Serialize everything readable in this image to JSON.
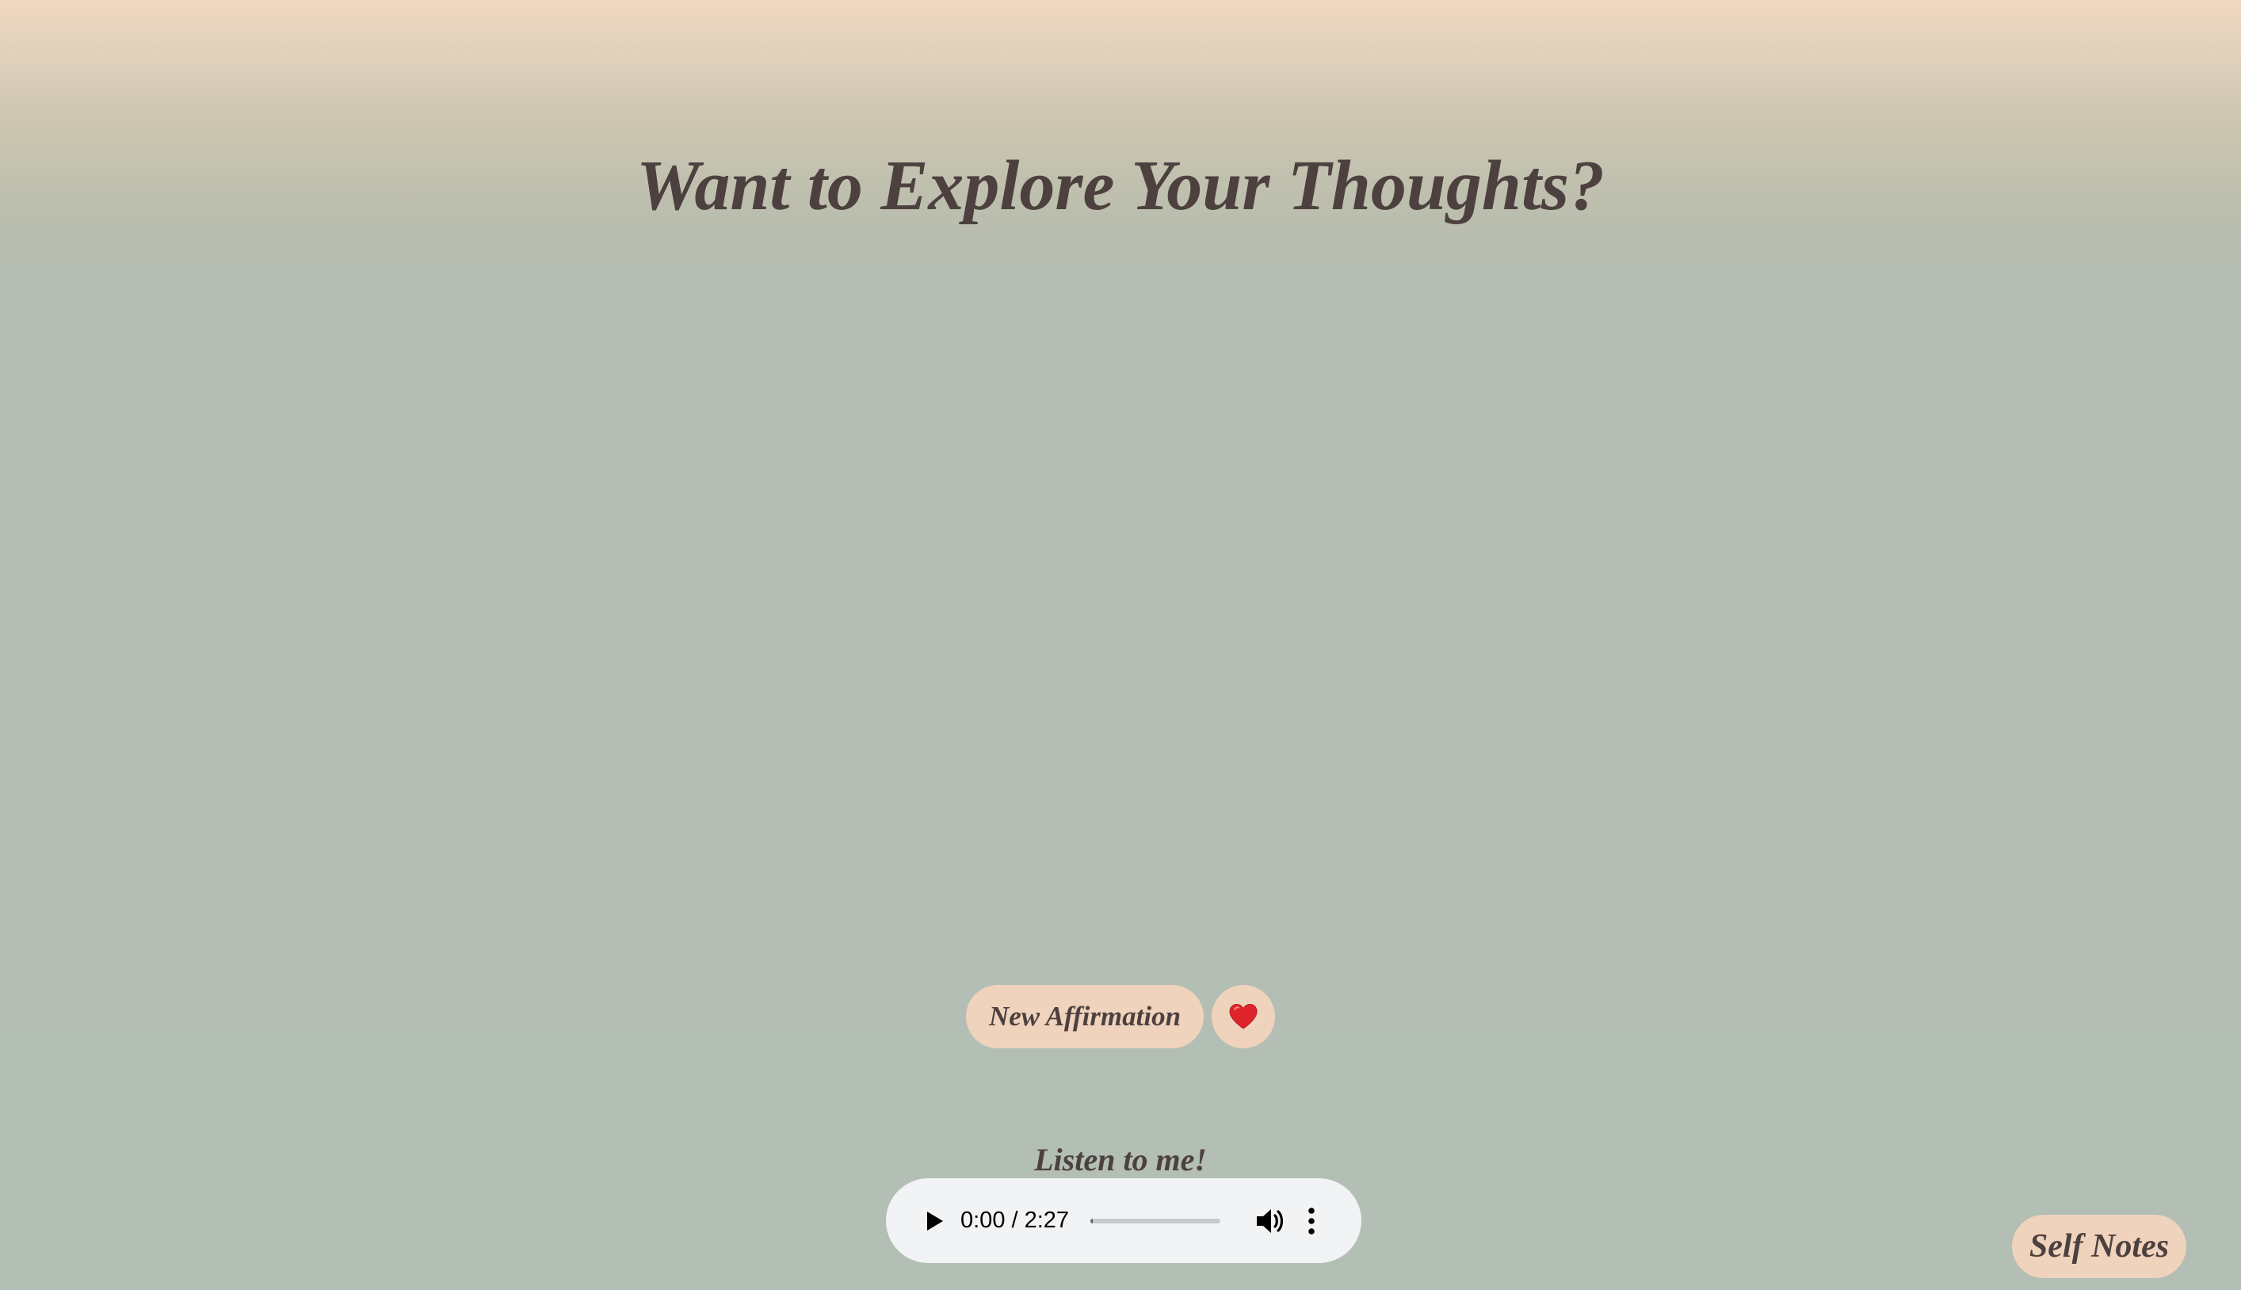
{
  "header": {
    "title": "Want to Explore Your Thoughts?"
  },
  "actions": {
    "new_affirmation_label": "New Affirmation",
    "favorite_icon": "heart-icon",
    "favorite_color": "#e0242b"
  },
  "audio": {
    "label": "Listen to me!",
    "time_display": "0:00 / 2:27",
    "current_time": "0:00",
    "duration": "2:27",
    "progress_fraction": 0.02,
    "icons": [
      "play-icon",
      "volume-icon",
      "more-options-icon"
    ]
  },
  "footer": {
    "self_notes_label": "Self Notes"
  },
  "colors": {
    "text": "#4d413f",
    "button_background": "#f0d3bd",
    "page_background": "#b3beb4",
    "gradient_top": "#f1d7c0",
    "player_background": "#f1f3f4"
  }
}
